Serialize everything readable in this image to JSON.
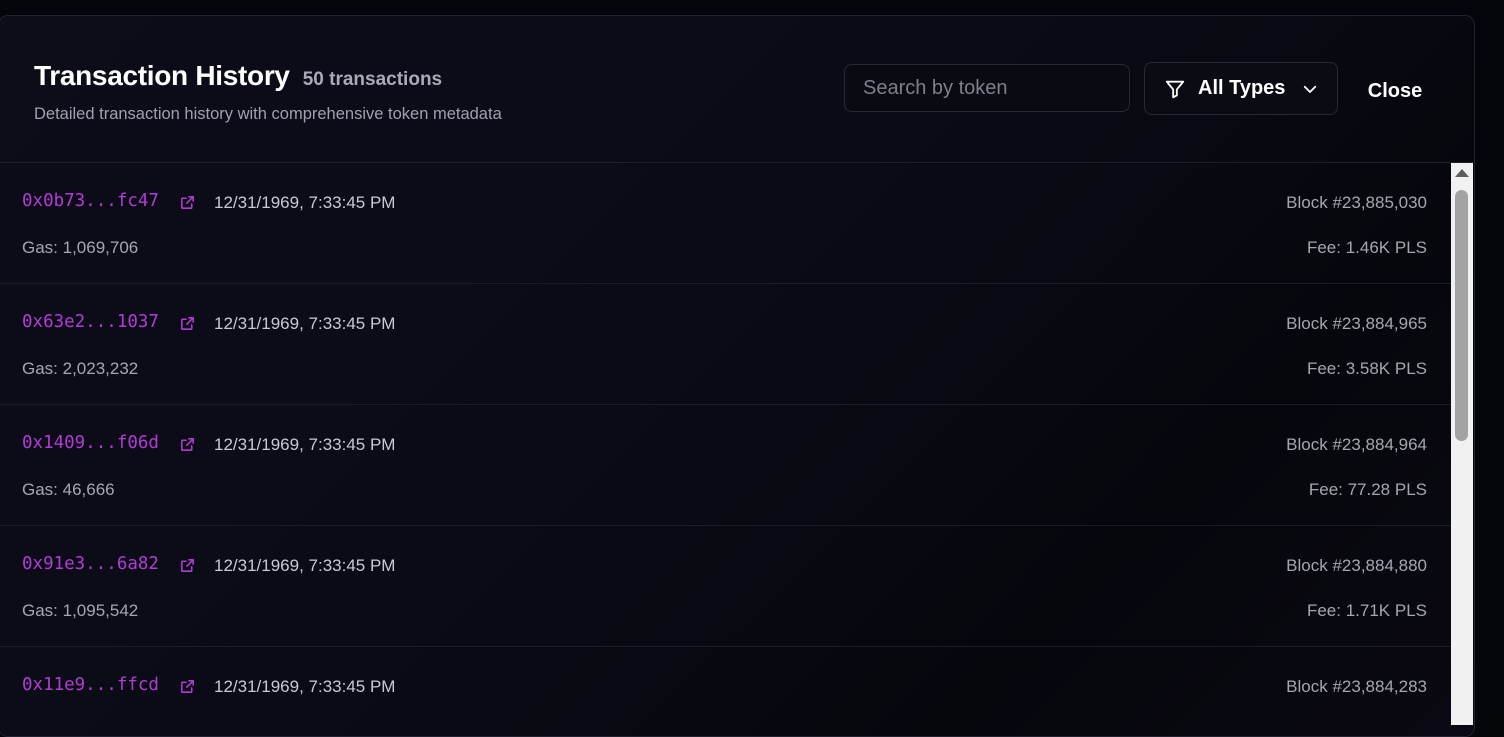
{
  "header": {
    "title": "Transaction History",
    "count": "50 transactions",
    "subtitle": "Detailed transaction history with comprehensive token metadata",
    "search_placeholder": "Search by token",
    "filter_label": "All Types",
    "close_label": "Close"
  },
  "colors": {
    "hash_link": "#b23bd6",
    "background": "#0a0b16",
    "border": "#1c1f2b"
  },
  "icons": {
    "filter": "funnel-icon",
    "dropdown": "chevron-down-icon",
    "external": "external-link-icon"
  },
  "transactions": [
    {
      "hash": "0x0b73...fc47",
      "time": "12/31/1969, 7:33:45 PM",
      "block": "Block #23,885,030",
      "gas": "Gas: 1,069,706",
      "fee": "Fee: 1.46K PLS"
    },
    {
      "hash": "0x63e2...1037",
      "time": "12/31/1969, 7:33:45 PM",
      "block": "Block #23,884,965",
      "gas": "Gas: 2,023,232",
      "fee": "Fee: 3.58K PLS"
    },
    {
      "hash": "0x1409...f06d",
      "time": "12/31/1969, 7:33:45 PM",
      "block": "Block #23,884,964",
      "gas": "Gas: 46,666",
      "fee": "Fee: 77.28 PLS"
    },
    {
      "hash": "0x91e3...6a82",
      "time": "12/31/1969, 7:33:45 PM",
      "block": "Block #23,884,880",
      "gas": "Gas: 1,095,542",
      "fee": "Fee: 1.71K PLS"
    },
    {
      "hash": "0x11e9...ffcd",
      "time": "12/31/1969, 7:33:45 PM",
      "block": "Block #23,884,283",
      "gas": "",
      "fee": ""
    }
  ]
}
